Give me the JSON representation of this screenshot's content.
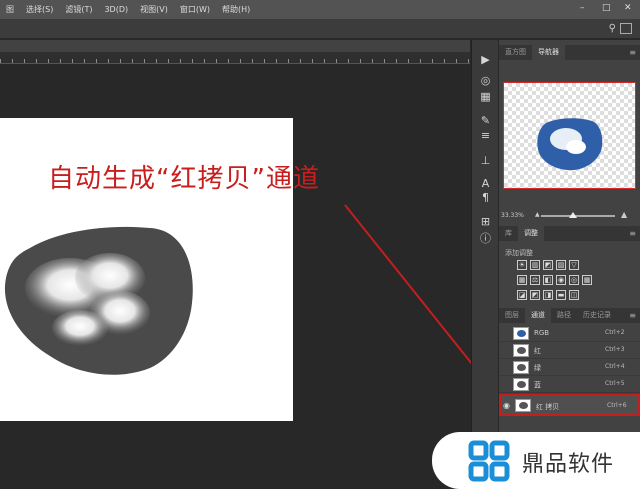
{
  "menubar": {
    "items": [
      "图",
      "选择(S)",
      "滤镜(T)",
      "3D(D)",
      "视图(V)",
      "窗口(W)",
      "帮助(H)"
    ]
  },
  "annotation": {
    "text": "自动生成“红拷贝”通道"
  },
  "panels": {
    "top_tabs": [
      "直方图",
      "导航器"
    ],
    "zoom": "33.33%",
    "mid_tabs": [
      "库",
      "调整"
    ],
    "adjust_title": "添加调整",
    "bottom_tabs": [
      "图层",
      "通道",
      "路径",
      "历史记录"
    ]
  },
  "channels": [
    {
      "name": "RGB",
      "shortcut": "Ctrl+2"
    },
    {
      "name": "红",
      "shortcut": "Ctrl+3"
    },
    {
      "name": "绿",
      "shortcut": "Ctrl+4"
    },
    {
      "name": "蓝",
      "shortcut": "Ctrl+5"
    },
    {
      "name": "红 拷贝",
      "shortcut": "Ctrl+6"
    }
  ],
  "brand": {
    "name": "鼎品软件"
  },
  "colors": {
    "annotation": "#c81e1e",
    "highlight_border": "#c41e1e",
    "channel_blue": "#2f5fa8"
  }
}
